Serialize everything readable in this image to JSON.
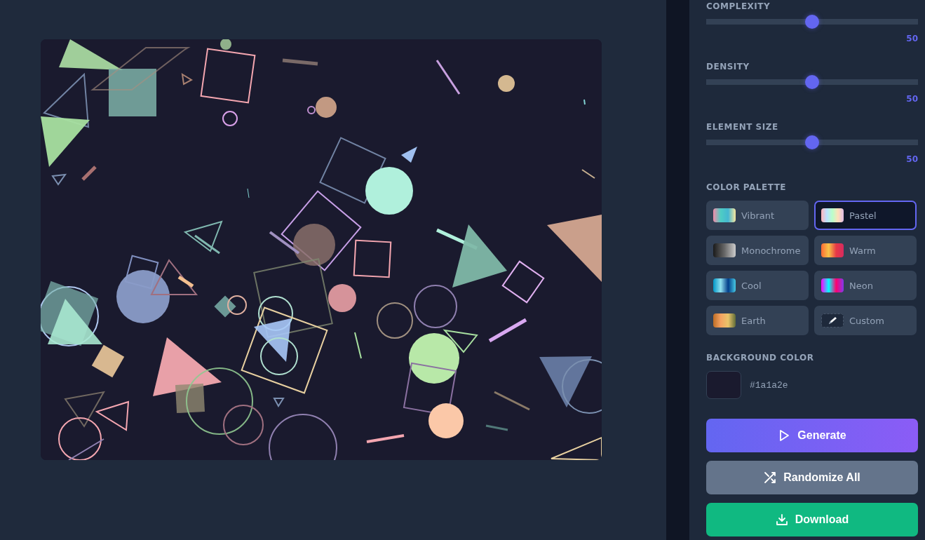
{
  "sliders": [
    {
      "label": "COMPLEXITY",
      "level": 0.5,
      "value": "50"
    },
    {
      "label": "DENSITY",
      "level": 0.5,
      "value": "50"
    },
    {
      "label": "ELEMENT SIZE",
      "level": 0.5,
      "value": "50"
    }
  ],
  "palette": {
    "label": "COLOR PALETTE",
    "options": [
      {
        "name": "Vibrant",
        "kind": "vibrant",
        "selected": false
      },
      {
        "name": "Pastel",
        "kind": "pastel",
        "selected": true
      },
      {
        "name": "Monochrome",
        "kind": "monochrome",
        "selected": false
      },
      {
        "name": "Warm",
        "kind": "warm",
        "selected": false
      },
      {
        "name": "Cool",
        "kind": "cool",
        "selected": false
      },
      {
        "name": "Neon",
        "kind": "neon",
        "selected": false
      },
      {
        "name": "Earth",
        "kind": "earth",
        "selected": false
      },
      {
        "name": "Custom",
        "kind": "custom",
        "selected": false
      }
    ]
  },
  "background": {
    "label": "BACKGROUND COLOR",
    "color": "#1a1a2e",
    "value": "#1a1a2e"
  },
  "buttons": [
    {
      "label": "Generate",
      "kind": "generate"
    },
    {
      "label": "Randomize All",
      "kind": "randomize"
    },
    {
      "label": "Download",
      "kind": "download"
    }
  ]
}
